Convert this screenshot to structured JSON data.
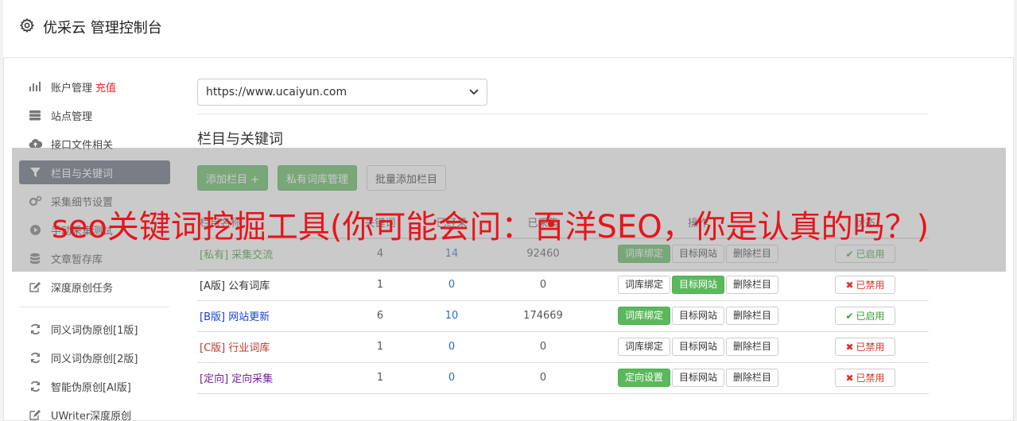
{
  "header": {
    "title": "优采云 管理控制台",
    "icon": "gear-icon"
  },
  "sidebar": {
    "items": [
      {
        "label": "账户管理",
        "extra": "充值",
        "icon": "bar-chart-icon",
        "active": false
      },
      {
        "label": "站点管理",
        "icon": "server-icon",
        "active": false
      },
      {
        "label": "接口文件相关",
        "icon": "cloud-upload-icon",
        "active": false
      },
      {
        "label": "栏目与关键词",
        "icon": "filter-icon",
        "active": true
      },
      {
        "label": "采集细节设置",
        "icon": "cogs-icon",
        "active": false
      },
      {
        "label": "手动采集测试",
        "icon": "play-circle-icon",
        "active": false
      },
      {
        "label": "文章暂存库",
        "icon": "database-icon",
        "active": false
      },
      {
        "label": "深度原创任务",
        "icon": "edit-icon",
        "active": false
      }
    ],
    "items2": [
      {
        "label": "同义词伪原创[1版]",
        "icon": "refresh-icon"
      },
      {
        "label": "同义词伪原创[2版]",
        "icon": "refresh-icon"
      },
      {
        "label": "智能伪原创[AI版]",
        "icon": "refresh-icon"
      },
      {
        "label": "UWriter深度原创",
        "icon": "edit-icon"
      }
    ]
  },
  "main": {
    "site_select": "https://www.ucaiyun.com",
    "section_title": "栏目与关键词",
    "buttons": {
      "add": "添加栏目 +",
      "private": "私有词库管理",
      "batch": "批量添加栏目"
    },
    "table": {
      "headers": [
        "栏目名称",
        "关键词",
        "已经采",
        "已采集",
        "操作",
        "状态"
      ],
      "rows": [
        {
          "tag": "[私有]",
          "name": "采集交流",
          "a": "4",
          "b": "14",
          "c": "92460",
          "op1": "词库绑定",
          "op1_green": true,
          "op2": "目标网站",
          "op2_green": false,
          "op3": "删除栏目",
          "status": "已启用",
          "on": true,
          "color": "#3c9a3c"
        },
        {
          "tag": "[A版]",
          "name": "公有词库",
          "a": "1",
          "b": "0",
          "c": "0",
          "op1": "词库绑定",
          "op1_green": false,
          "op2": "目标网站",
          "op2_green": true,
          "op3": "删除栏目",
          "status": "已禁用",
          "on": false,
          "color": "#333333"
        },
        {
          "tag": "[B版]",
          "name": "网站更新",
          "a": "6",
          "b": "10",
          "c": "174669",
          "op1": "词库绑定",
          "op1_green": true,
          "op2": "目标网站",
          "op2_green": false,
          "op3": "删除栏目",
          "status": "已启用",
          "on": true,
          "color": "#1a3fd1"
        },
        {
          "tag": "[C版]",
          "name": "行业词库",
          "a": "1",
          "b": "0",
          "c": "0",
          "op1": "词库绑定",
          "op1_green": false,
          "op2": "目标网站",
          "op2_green": false,
          "op3": "删除栏目",
          "status": "已禁用",
          "on": false,
          "color": "#c0392b"
        },
        {
          "tag": "[定向]",
          "name": "定向采集",
          "a": "1",
          "b": "0",
          "c": "0",
          "op1": "定向设置",
          "op1_green": true,
          "op2": "目标网站",
          "op2_green": false,
          "op3": "删除栏目",
          "status": "已禁用",
          "on": false,
          "color": "#7b1fa2"
        }
      ]
    }
  },
  "overlay": {
    "title": "seo关键词挖掘工具(你可能会问：百洋SEO，你是认真的吗？)"
  }
}
